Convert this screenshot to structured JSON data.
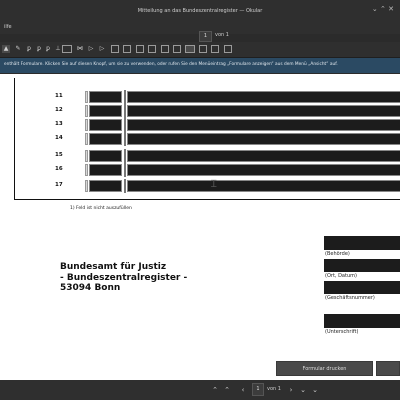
{
  "window": {
    "title": "Mitteilung an das Bundeszentralregister — Okular"
  },
  "menubar": {
    "label": "ilfe"
  },
  "pager": {
    "current": "1",
    "of_label": "von",
    "total": "1"
  },
  "toolbar": {
    "icons": [
      "cursor-icon",
      "pen-icon",
      "text-p-icon",
      "text-p-icon",
      "text-p-icon",
      "text-p-icon",
      "stamp-icon",
      "selection-dropdown-icon",
      "back-icon",
      "next-icon",
      "first-icon",
      "last-icon",
      "layout-single-icon",
      "layout-facing-icon",
      "layout-continuous-icon",
      "layout-grid-icon",
      "presentation-icon",
      "rotate-left-icon",
      "rotate-right-icon",
      "trim-icon",
      "fit-icon"
    ]
  },
  "infobar": {
    "message": "enthält Formulare. Klicken Sie auf diesen Knopf, um sie zu verwenden, oder rufen Sie den Menüeintrag „Formulare anzeigen“ aus dem Menü „Ansicht“ auf."
  },
  "form": {
    "rows": [
      "11",
      "12",
      "13",
      "14",
      "15",
      "16",
      "17"
    ],
    "footnote": "1) Feld ist nicht auszufüllen",
    "address": [
      "Bundesamt für Justiz",
      "- Bundeszentralregister -",
      "53094 Bonn"
    ],
    "right_labels": [
      "(Behörde)",
      "(Ort, Datum)",
      "(Geschäftsnummer)",
      "(Unterschrift)"
    ],
    "print_button": "Formular drucken"
  },
  "statusbar": {
    "current": "1",
    "of_label": "von",
    "total": "1"
  }
}
